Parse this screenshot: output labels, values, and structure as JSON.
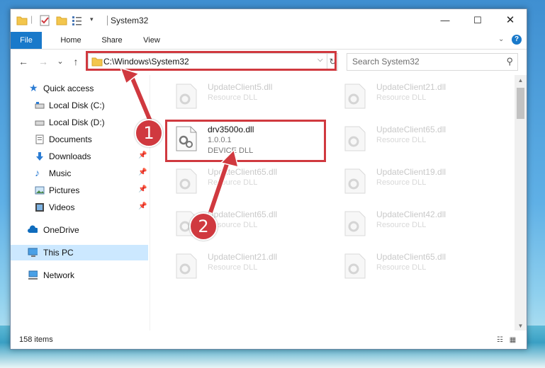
{
  "window": {
    "title": "System32",
    "controls": {
      "minimize": "—",
      "maximize": "☐",
      "close": "✕"
    }
  },
  "ribbon": {
    "tabs": [
      "File",
      "Home",
      "Share",
      "View"
    ]
  },
  "address_bar": {
    "path": "C:\\Windows\\System32",
    "dropdown": "⌵",
    "refresh": "↻"
  },
  "search": {
    "placeholder": "Search System32",
    "icon": "search-icon"
  },
  "navigation": {
    "back": "←",
    "forward": "→",
    "recent": "⌄",
    "up": "↑"
  },
  "sidebar": {
    "items": [
      {
        "label": "Quick access",
        "icon": "star-icon",
        "pinned": false
      },
      {
        "label": "Local Disk (C:)",
        "icon": "drive-icon",
        "pinned": true
      },
      {
        "label": "Local Disk (D:)",
        "icon": "drive-icon",
        "pinned": true
      },
      {
        "label": "Documents",
        "icon": "documents-icon",
        "pinned": true
      },
      {
        "label": "Downloads",
        "icon": "download-icon",
        "pinned": true
      },
      {
        "label": "Music",
        "icon": "music-icon",
        "pinned": true
      },
      {
        "label": "Pictures",
        "icon": "pictures-icon",
        "pinned": true
      },
      {
        "label": "Videos",
        "icon": "videos-icon",
        "pinned": true
      },
      {
        "label": "OneDrive",
        "icon": "cloud-icon",
        "pinned": false
      },
      {
        "label": "This PC",
        "icon": "computer-icon",
        "pinned": false,
        "selected": true
      },
      {
        "label": "Network",
        "icon": "network-icon",
        "pinned": false
      }
    ]
  },
  "files": [
    {
      "name": "UpdateClient5.dll",
      "type": "Resource DLL"
    },
    {
      "name": "UpdateClient21.dll",
      "type": "Resource DLL"
    },
    {
      "name": "drv3500o.dll",
      "version": "1.0.0.1",
      "type": "DEVICE DLL",
      "highlighted": true
    },
    {
      "name": "UpdateClient65.dll",
      "type": "Resource DLL"
    },
    {
      "name": "UpdateClient65.dll",
      "type": "Resource DLL"
    },
    {
      "name": "UpdateClient19.dll",
      "type": "Resource DLL"
    },
    {
      "name": "UpdateClient65.dll",
      "type": "Resource DLL"
    },
    {
      "name": "UpdateClient42.dll",
      "type": "Resource DLL"
    },
    {
      "name": "UpdateClient21.dll",
      "type": "Resource DLL"
    },
    {
      "name": "UpdateClient65.dll",
      "type": "Resource DLL"
    }
  ],
  "status": {
    "item_count": "158 items"
  },
  "callouts": [
    "1",
    "2"
  ],
  "colors": {
    "accent": "#1979ca",
    "annotation": "#d0393f",
    "selection": "#cce8ff"
  }
}
